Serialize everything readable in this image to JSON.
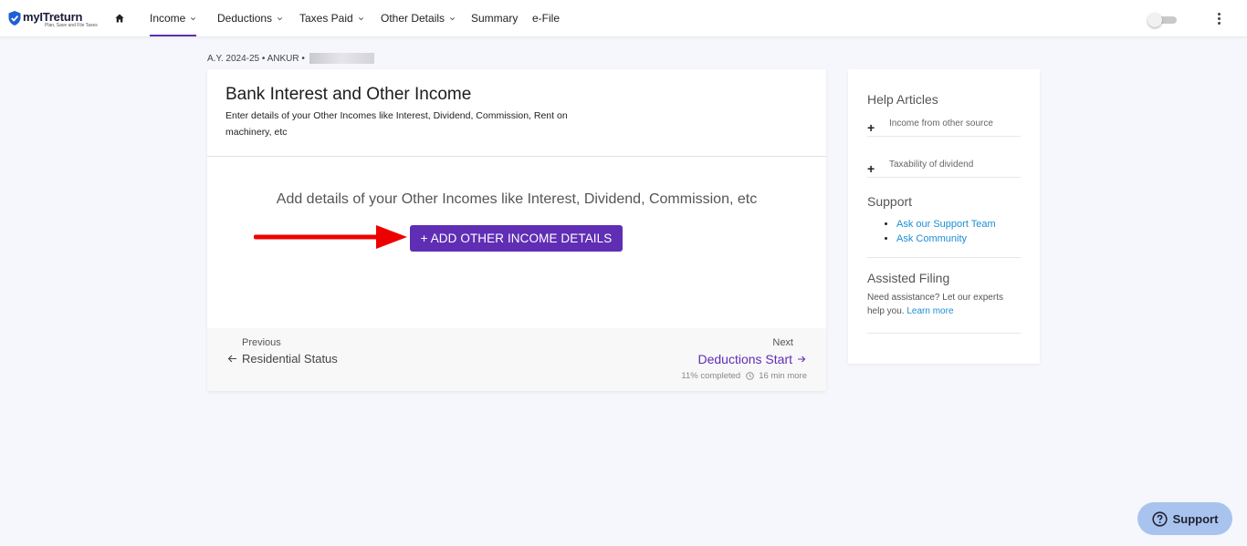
{
  "brand": {
    "name": "myITreturn",
    "tagline": "Plan, Save and File Taxes",
    "accent": "#5f2eb4",
    "link_color": "#1a8fd4"
  },
  "nav": {
    "items": [
      {
        "label": "Income",
        "has_dropdown": true,
        "active": true
      },
      {
        "label": "Deductions",
        "has_dropdown": true
      },
      {
        "label": "Taxes Paid",
        "has_dropdown": true
      },
      {
        "label": "Other Details",
        "has_dropdown": true
      },
      {
        "label": "Summary"
      },
      {
        "label": "e-File"
      }
    ]
  },
  "breadcrumb": {
    "text": "A.Y. 2024-25 • ANKUR •"
  },
  "page": {
    "title": "Bank Interest and Other Income",
    "subtitle": "Enter details of your Other Incomes like Interest, Dividend, Commission, Rent on machinery, etc",
    "prompt": "Add details of your Other Incomes like Interest, Dividend, Commission, etc",
    "add_button": "+ ADD OTHER INCOME DETAILS"
  },
  "footer": {
    "previous_caption": "Previous",
    "previous_link": "Residential Status",
    "next_caption": "Next",
    "next_link": "Deductions Start",
    "progress_text": "11% completed",
    "time_text": "16 min more"
  },
  "sidebar": {
    "help_title": "Help Articles",
    "articles": [
      "Income from other source",
      "Taxability of dividend"
    ],
    "support_title": "Support",
    "support_links": [
      "Ask our Support Team",
      "Ask Community"
    ],
    "assisted_title": "Assisted Filing",
    "assisted_text": "Need assistance? Let our experts help you.",
    "learn_more": "Learn more"
  },
  "support_fab": {
    "label": "Support"
  }
}
